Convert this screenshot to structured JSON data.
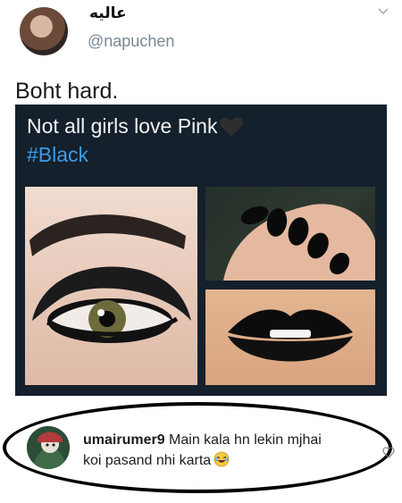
{
  "tweet": {
    "display_name": "عاليه",
    "handle": "@napuchen",
    "text": "Boht hard."
  },
  "image": {
    "title": "Not all girls love Pink",
    "hashtag": "#Black"
  },
  "comment": {
    "username": "umairumer9",
    "text_line1": "Main kala hn lekin mjhai",
    "text_line2": "koi pasand nhi karta"
  },
  "colors": {
    "handle": "#7a8791",
    "hashtag": "#3d9ae8",
    "media_bg": "#14202b"
  }
}
